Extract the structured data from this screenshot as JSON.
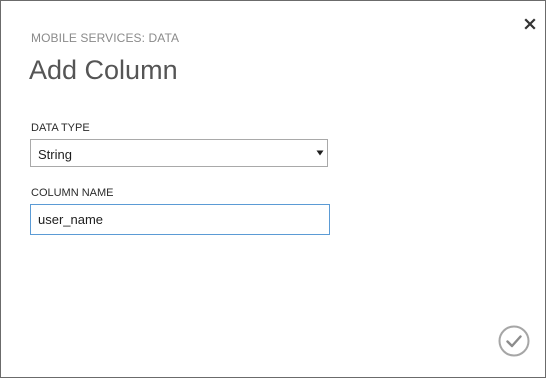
{
  "dialog": {
    "section_label": "MOBILE SERVICES: DATA",
    "title": "Add Column"
  },
  "fields": {
    "data_type": {
      "label": "DATA TYPE",
      "selected": "String"
    },
    "column_name": {
      "label": "COLUMN NAME",
      "value": "user_name"
    }
  },
  "icons": {
    "close": "close-icon",
    "dropdown": "triangle-down-icon",
    "confirm": "checkmark-circle-icon"
  },
  "colors": {
    "border": "#6b6b6b",
    "input_focus": "#5b9bd5",
    "muted_text": "#8a8a8a",
    "confirm_icon": "#a6a6a6"
  }
}
